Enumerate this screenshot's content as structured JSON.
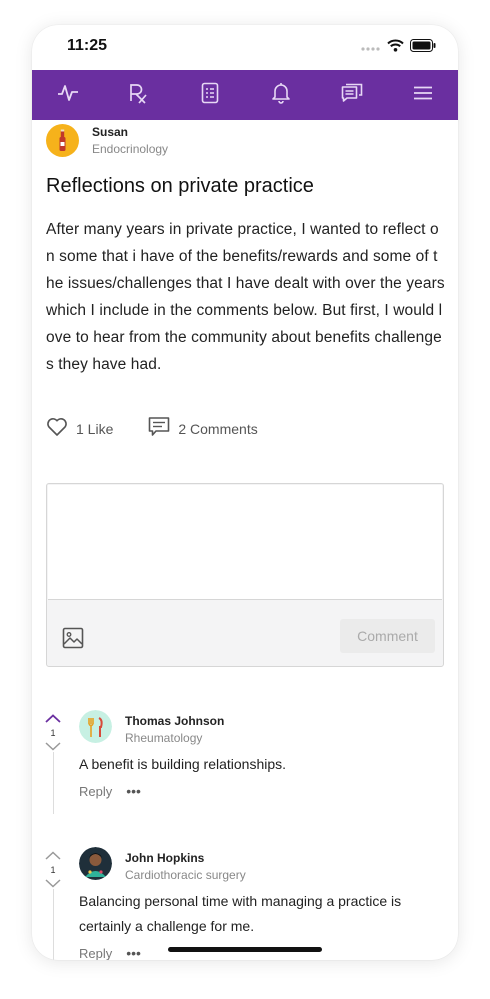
{
  "status_bar": {
    "time": "11:25"
  },
  "nav": {
    "items": [
      "activity-icon",
      "rx-icon",
      "clipboard-icon",
      "bell-icon",
      "chat-icon",
      "menu-icon"
    ],
    "color": "#6a2fa0"
  },
  "post": {
    "author_name": "Susan",
    "author_specialty": "Endocrinology",
    "title": "Reflections on private practice",
    "body": "After many years in private practice, I wanted to reflect on some that i have of the benefits/rewards and some of the issues/challenges that I have dealt with over the years which I include in the comments below. But first, I would love to hear from the community about benefits challenges they have had.",
    "likes_label": "1 Like",
    "comments_label": "2 Comments"
  },
  "composer": {
    "placeholder": "",
    "submit_label": "Comment"
  },
  "comments": [
    {
      "votes": "1",
      "author_name": "Thomas Johnson",
      "author_specialty": "Rheumatology",
      "text": "A benefit is building relationships.",
      "reply_label": "Reply",
      "more_label": "•••"
    },
    {
      "votes": "1",
      "author_name": "John Hopkins",
      "author_specialty": "Cardiothoracic surgery",
      "text": "Balancing personal time with managing a practice is certainly a challenge for me.",
      "reply_label": "Reply",
      "more_label": "•••"
    }
  ]
}
